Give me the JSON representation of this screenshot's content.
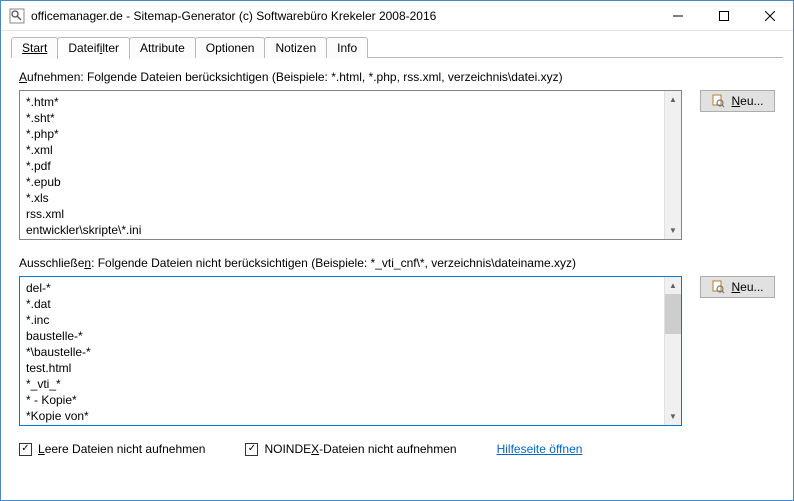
{
  "titlebar": {
    "title": "officemanager.de - Sitemap-Generator (c) Softwarebüro Krekeler 2008-2016"
  },
  "tabs": {
    "start": "Start",
    "dateifilter_pre": "Dateif",
    "dateifilter_u": "i",
    "dateifilter_post": "lter",
    "attribute": "Attribute",
    "optionen": "Optionen",
    "notizen": "Notizen",
    "info": "Info"
  },
  "include": {
    "label_pre": "",
    "label_u": "A",
    "label_post": "ufnehmen: Folgende Dateien berücksichtigen (Beispiele: *.html, *.php, rss.xml, verzeichnis\\datei.xyz)",
    "value": "*.htm*\n*.sht*\n*.php*\n*.xml\n*.pdf\n*.epub\n*.xls\nrss.xml\nentwickler\\skripte\\*.ini",
    "button_u": "N",
    "button_post": "eu..."
  },
  "exclude": {
    "label_pre": "Ausschließe",
    "label_u": "n",
    "label_post": ": Folgende Dateien nicht berücksichtigen (Beispiele: *_vti_cnf\\*, verzeichnis\\dateiname.xyz)",
    "value": "del-*\n*.dat\n*.inc\nbaustelle-*\n*\\baustelle-*\ntest.html\n*_vti_*\n* - Kopie*\n*Kopie von*",
    "button_u": "N",
    "button_post": "eu..."
  },
  "options": {
    "empty_u": "L",
    "empty_post": "eere Dateien nicht aufnehmen",
    "noindex_pre": "NOINDE",
    "noindex_u": "X",
    "noindex_post": "-Dateien nicht aufnehmen",
    "help": "Hilfeseite öffnen"
  }
}
